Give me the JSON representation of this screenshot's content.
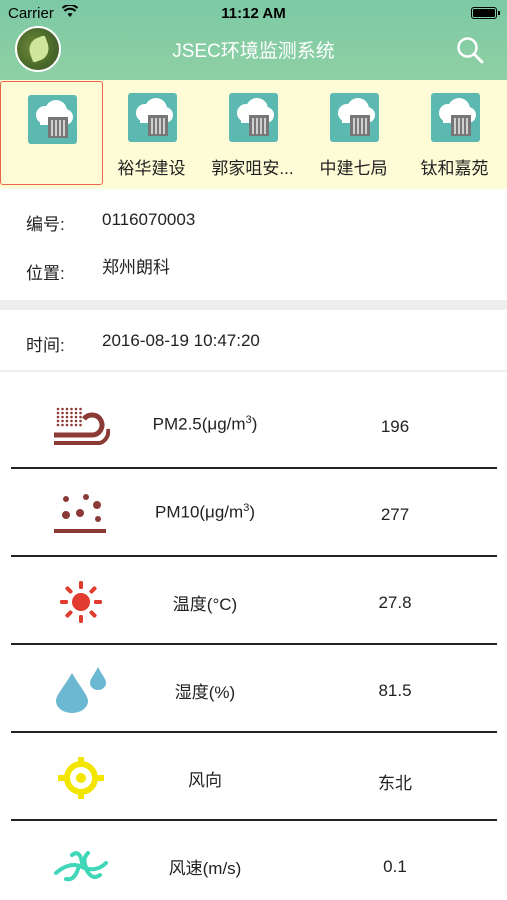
{
  "status_bar": {
    "carrier": "Carrier",
    "time": "11:12 AM"
  },
  "header": {
    "title": "JSEC环境监测系统"
  },
  "stations": [
    {
      "label": ""
    },
    {
      "label": "裕华建设"
    },
    {
      "label": "郭家咀安..."
    },
    {
      "label": "中建七局"
    },
    {
      "label": "钛和嘉苑"
    }
  ],
  "info": {
    "code_label": "编号:",
    "code_value": "0116070003",
    "location_label": "位置:",
    "location_value": "郑州朗科",
    "time_label": "时间:",
    "time_value": "2016-08-19 10:47:20"
  },
  "metrics": [
    {
      "label_main": "PM2.5(μg/m",
      "label_sup": "3",
      "label_tail": ")",
      "value": "196",
      "icon": "dust-pm25-icon"
    },
    {
      "label_main": "PM10(μg/m",
      "label_sup": "3",
      "label_tail": ")",
      "value": "277",
      "icon": "dust-pm10-icon"
    },
    {
      "label_main": "温度(°C)",
      "label_sup": "",
      "label_tail": "",
      "value": "27.8",
      "icon": "sun-icon"
    },
    {
      "label_main": "湿度(%)",
      "label_sup": "",
      "label_tail": "",
      "value": "81.5",
      "icon": "water-drop-icon"
    },
    {
      "label_main": "风向",
      "label_sup": "",
      "label_tail": "",
      "value": "东北",
      "icon": "wind-direction-icon"
    },
    {
      "label_main": "风速(m/s)",
      "label_sup": "",
      "label_tail": "",
      "value": "0.1",
      "icon": "wind-speed-icon"
    }
  ],
  "colors": {
    "header": "#7cc9a5",
    "station_strip": "#fdfcd6",
    "station_icon": "#5bb9b1",
    "selected_border": "#e8674a"
  }
}
